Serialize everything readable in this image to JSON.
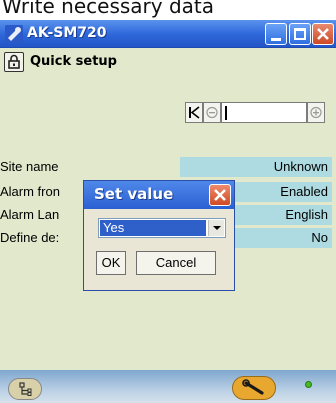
{
  "caption": "Write necessary data",
  "window": {
    "title": "AK-SM720",
    "icon": "tool-icon",
    "controls": [
      "minimize",
      "maximize",
      "close"
    ]
  },
  "page": {
    "title": "Quick setup"
  },
  "rows": [
    {
      "label": "Site name",
      "value": "Unknown"
    },
    {
      "label": "Alarm fron",
      "value": "Enabled"
    },
    {
      "label": "Alarm Lan",
      "value": "English"
    },
    {
      "label": "Define de:",
      "value": "No"
    }
  ],
  "dialog": {
    "title": "Set value",
    "selected": "Yes",
    "ok_label": "OK",
    "cancel_label": "Cancel"
  },
  "colors": {
    "background": "#e2e8cb",
    "value_cell": "#aedbe1",
    "titlebar": "#2d66d9",
    "selection": "#2f5fc9"
  }
}
